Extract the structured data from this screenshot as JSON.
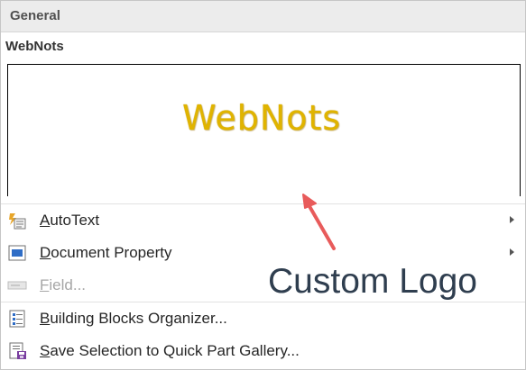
{
  "section": {
    "title": "General"
  },
  "gallery_item": {
    "title": "WebNots",
    "preview_text": "WebNots",
    "preview_color": "#e0b400"
  },
  "menu": {
    "items": [
      {
        "label": "AutoText",
        "underline": "A",
        "rest": "utoText",
        "icon": "autotext-icon",
        "has_submenu": true,
        "enabled": true
      },
      {
        "label": "Document Property",
        "underline": "D",
        "rest": "ocument Property",
        "icon": "document-property-icon",
        "has_submenu": true,
        "enabled": true
      },
      {
        "label": "Field...",
        "underline": "F",
        "rest": "ield...",
        "icon": "field-icon",
        "has_submenu": false,
        "enabled": false
      },
      {
        "label": "Building Blocks Organizer...",
        "underline": "B",
        "rest": "uilding Blocks Organizer...",
        "icon": "building-blocks-icon",
        "has_submenu": false,
        "enabled": true
      },
      {
        "label": "Save Selection to Quick Part Gallery...",
        "underline": "S",
        "rest": "ave Selection to Quick Part Gallery...",
        "icon": "save-selection-icon",
        "has_submenu": false,
        "enabled": true
      }
    ]
  },
  "annotation": {
    "text": "Custom Logo",
    "arrow_color": "#e85b5b",
    "text_color": "#2f3e4f"
  }
}
